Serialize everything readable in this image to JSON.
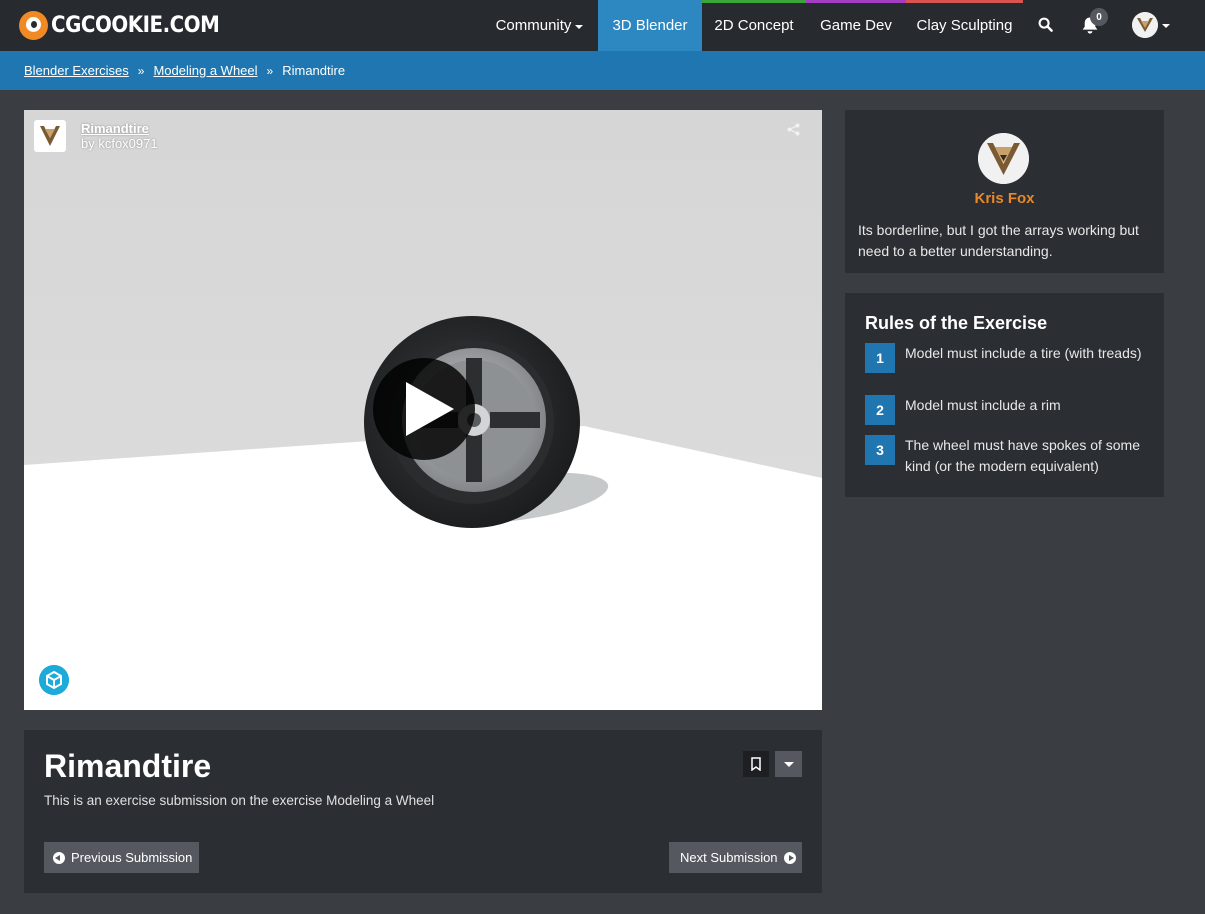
{
  "header": {
    "logo_text": "CGCOOKIE.COM",
    "nav": [
      {
        "label": "Community",
        "accent": ""
      },
      {
        "label": "3D Blender",
        "accent": "#2d87c0"
      },
      {
        "label": "2D Concept",
        "accent": "#3aa63a"
      },
      {
        "label": "Game Dev",
        "accent": "#a43fc4"
      },
      {
        "label": "Clay Sculpting",
        "accent": "#d9534f"
      }
    ],
    "notification_count": "0"
  },
  "breadcrumb": {
    "items": [
      "Blender Exercises",
      "Modeling a Wheel"
    ],
    "current": "Rimandtire",
    "separator": "»"
  },
  "viewer": {
    "title": "Rimandtire",
    "byline": "by kcfox0971"
  },
  "submission": {
    "title": "Rimandtire",
    "description": "This is an exercise submission on the exercise Modeling a Wheel",
    "prev_label": "Previous Submission",
    "next_label": "Next Submission"
  },
  "author": {
    "name": "Kris Fox",
    "comment": "Its borderline, but I got the arrays working but need to a better understanding."
  },
  "rules": {
    "title": "Rules of the Exercise",
    "items": [
      {
        "num": "1",
        "text": "Model must include a tire (with treads)"
      },
      {
        "num": "2",
        "text": "Model must include a rim"
      },
      {
        "num": "3",
        "text": "The wheel must have spokes of some kind (or the modern equivalent)"
      }
    ]
  },
  "colors": {
    "brand_orange": "#f08a24",
    "primary_blue": "#1f76b0",
    "author_orange": "#e8882a"
  }
}
